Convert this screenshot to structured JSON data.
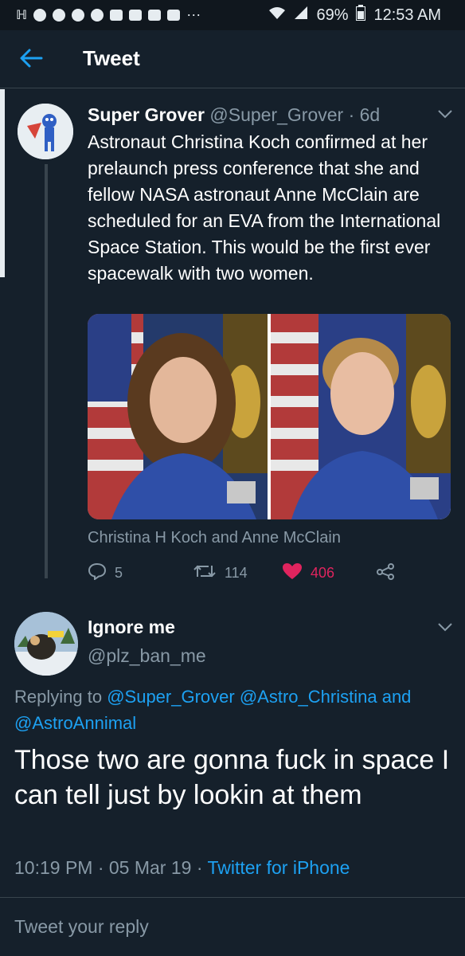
{
  "status_bar": {
    "battery": "69%",
    "time": "12:53 AM"
  },
  "header": {
    "title": "Tweet"
  },
  "tweet": {
    "name": "Super Grover",
    "handle": "@Super_Grover",
    "age": "· 6d",
    "body": "Astronaut Christina Koch confirmed at her prelaunch press conference that she and fellow NASA astronaut Anne McClain are scheduled for an EVA from the International Space Station. This would be the first ever spacewalk with two women.",
    "media_caption": "Christina H Koch and Anne McClain",
    "replies": "5",
    "retweets": "114",
    "likes": "406"
  },
  "reply": {
    "name": "Ignore me",
    "handle": "@plz_ban_me",
    "replying_prefix": "Replying to",
    "replying_to": [
      "@Super_Grover",
      "@Astro_Christina"
    ],
    "and": "and",
    "replying_last": "@AstroAnnimal",
    "body": "Those two are gonna fuck in space I can tell just by lookin at them",
    "time": "10:19 PM · 05 Mar 19 ·",
    "client": "Twitter for iPhone"
  },
  "compose": {
    "placeholder": "Tweet your reply"
  },
  "colors": {
    "background": "#15202b",
    "accent": "#1da1f2",
    "like": "#e0245e",
    "muted": "#8899a6"
  }
}
